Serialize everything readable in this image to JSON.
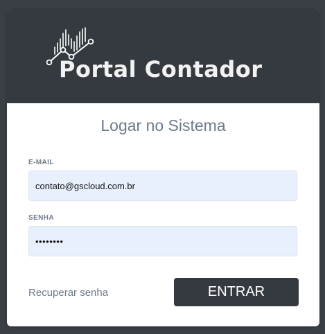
{
  "brand": {
    "title": "Portal Contador",
    "icon": "chart-growth-icon",
    "background_color": "#353a40"
  },
  "login": {
    "title": "Logar no Sistema",
    "email": {
      "label": "E-MAIL",
      "value": "contato@gscloud.com.br"
    },
    "password": {
      "label": "SENHA",
      "value": "••••••••"
    },
    "recover_label": "Recuperar senha",
    "submit_label": "ENTRAR"
  },
  "colors": {
    "accent": "#353a40",
    "input_background": "#e8f0fe",
    "muted_text": "#6b7a8c"
  }
}
